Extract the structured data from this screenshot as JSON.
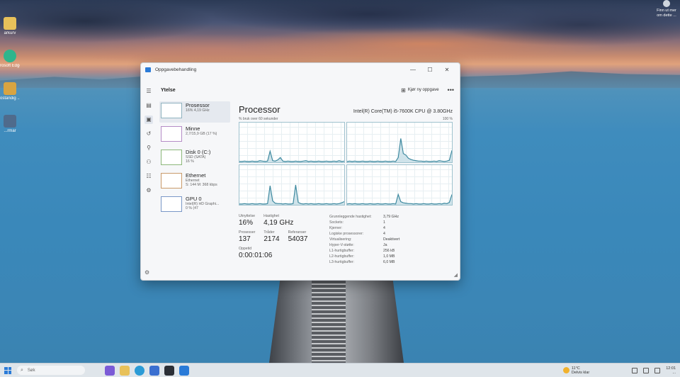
{
  "desktop": {
    "icons": [
      {
        "label": "arkurv",
        "icon": "folder-icon",
        "color": "#e8c15a"
      },
      {
        "label": "rosoft Edge",
        "icon": "edge-icon",
        "color": "#2fb58c"
      },
      {
        "label": "ostandig ...",
        "icon": "app-icon",
        "color": "#d9a441"
      },
      {
        "label": "...rmar",
        "icon": "app-icon",
        "color": "#4f6b8c"
      }
    ],
    "corner_notice": "Finn ut mer om dette ..."
  },
  "window": {
    "title": "Oppgavebehandling",
    "controls": {
      "minimize": "—",
      "maximize": "☐",
      "close": "✕"
    },
    "section_title": "Ytelse",
    "new_task_label": "Kjør ny oppgave",
    "more_label": "•••",
    "nav": [
      {
        "icon": "menu-icon",
        "glyph": "☰"
      },
      {
        "icon": "processes-icon",
        "glyph": "▤"
      },
      {
        "icon": "performance-icon",
        "glyph": "▣"
      },
      {
        "icon": "app-history-icon",
        "glyph": "↺"
      },
      {
        "icon": "startup-icon",
        "glyph": "⚲"
      },
      {
        "icon": "users-icon",
        "glyph": "⚇"
      },
      {
        "icon": "details-icon",
        "glyph": "☷"
      },
      {
        "icon": "services-icon",
        "glyph": "⚙"
      }
    ],
    "settings_glyph": "⚙",
    "resources": [
      {
        "name": "Prosessor",
        "sub1": "16% 4,19 GHz",
        "sub2": ""
      },
      {
        "name": "Minne",
        "sub1": "2,7/15,9 GB (17 %)",
        "sub2": ""
      },
      {
        "name": "Disk 0 (C:)",
        "sub1": "SSD (SATA)",
        "sub2": "16 %"
      },
      {
        "name": "Ethernet",
        "sub1": "Ethernet",
        "sub2": "S: 144 M: 368 kbps"
      },
      {
        "name": "GPU 0",
        "sub1": "Intel(R) HD Graphi...",
        "sub2": "0 % (47"
      }
    ]
  },
  "processor": {
    "heading": "Processor",
    "cpu_name": "Intel(R) Core(TM) i5-7600K CPU @ 3.80GHz",
    "axis_left": "% bruk over 60 sekunder",
    "axis_right": "100 %",
    "utilization_label": "Utnyttelse",
    "utilization": "16%",
    "speed_label": "Hastighet",
    "speed": "4,19 GHz",
    "processes_label": "Prosesser",
    "processes": "137",
    "threads_label": "Tråder",
    "threads": "2174",
    "handles_label": "Referanser",
    "handles": "54037",
    "uptime_label": "Oppetid",
    "uptime": "0:00:01:06",
    "specs": [
      {
        "k": "Grunnleggende hastighet:",
        "v": "3,79 GHz"
      },
      {
        "k": "Sockets:",
        "v": "1"
      },
      {
        "k": "Kjerner:",
        "v": "4"
      },
      {
        "k": "Logiske prosessorer:",
        "v": "4"
      },
      {
        "k": "Virtualisering:",
        "v": "Deaktivert"
      },
      {
        "k": "Hyper-V-støtte:",
        "v": "Ja"
      },
      {
        "k": "L1-hurtigbuffer:",
        "v": "256 kB"
      },
      {
        "k": "L2-hurtigbuffer:",
        "v": "1,0 MB"
      },
      {
        "k": "L3-hurtigbuffer:",
        "v": "6,0 MB"
      }
    ],
    "core_series": [
      [
        2,
        2,
        3,
        2,
        2,
        3,
        2,
        2,
        4,
        3,
        2,
        3,
        28,
        4,
        3,
        6,
        12,
        3,
        2,
        3,
        2,
        2,
        3,
        2,
        2,
        3,
        4,
        2,
        3,
        2,
        2,
        3,
        2,
        2,
        3,
        2,
        2,
        3,
        2,
        4,
        2,
        3
      ],
      [
        2,
        3,
        2,
        3,
        2,
        2,
        3,
        2,
        2,
        3,
        2,
        2,
        3,
        2,
        2,
        3,
        2,
        2,
        3,
        2,
        12,
        60,
        22,
        18,
        10,
        7,
        5,
        4,
        3,
        3,
        2,
        3,
        2,
        2,
        3,
        2,
        4,
        3,
        2,
        3,
        5,
        30
      ],
      [
        2,
        2,
        3,
        2,
        2,
        3,
        2,
        2,
        3,
        2,
        2,
        3,
        48,
        10,
        4,
        3,
        3,
        2,
        3,
        2,
        2,
        3,
        50,
        6,
        3,
        2,
        3,
        2,
        3,
        2,
        2,
        3,
        2,
        2,
        3,
        2,
        2,
        3,
        2,
        3,
        5,
        8
      ],
      [
        2,
        3,
        2,
        3,
        2,
        2,
        3,
        2,
        2,
        3,
        2,
        2,
        3,
        2,
        2,
        3,
        2,
        2,
        3,
        2,
        26,
        8,
        5,
        4,
        3,
        3,
        2,
        3,
        2,
        2,
        3,
        2,
        2,
        3,
        2,
        2,
        3,
        2,
        4,
        3,
        6,
        26
      ]
    ]
  },
  "taskbar": {
    "search_placeholder": "Søk",
    "apps": [
      {
        "icon": "copilot-icon",
        "color": "#7b5bd6"
      },
      {
        "icon": "file-explorer-icon",
        "color": "#e8c15a"
      },
      {
        "icon": "edge-icon",
        "color": "#2b9bd6"
      },
      {
        "icon": "store-icon",
        "color": "#3a6fd0"
      },
      {
        "icon": "terminal-icon",
        "color": "#2b2f36"
      },
      {
        "icon": "task-manager-icon",
        "color": "#2a7bd8"
      }
    ],
    "weather_temp": "11°C",
    "weather_desc": "Delvis klar",
    "clock_time": "12:01",
    "clock_date": "..."
  }
}
